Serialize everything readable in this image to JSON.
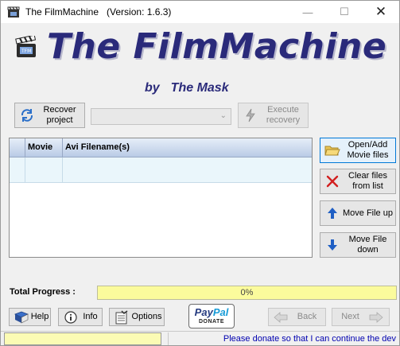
{
  "window": {
    "title": "The FilmMachine",
    "version": "(Version: 1.6.3)"
  },
  "brand": {
    "title": "The FilmMachine",
    "by": "by",
    "author": "The Mask"
  },
  "toolbar": {
    "recover_line1": "Recover",
    "recover_line2": "project",
    "project_select_value": "",
    "execute_line1": "Execute",
    "execute_line2": "recovery"
  },
  "table": {
    "columns": [
      "",
      "Movie",
      "Avi Filename(s)"
    ]
  },
  "side_buttons": {
    "open_add_line1": "Open/Add",
    "open_add_line2": "Movie files",
    "clear_line1": "Clear files",
    "clear_line2": "from list",
    "move_up": "Move File up",
    "move_down_line1": "Move File",
    "move_down_line2": "down"
  },
  "progress": {
    "label": "Total Progress :",
    "value": 0,
    "text": "0%"
  },
  "bottom": {
    "help": "Help",
    "info": "Info",
    "options": "Options",
    "back": "Back",
    "next": "Next"
  },
  "paypal": {
    "brand_part1": "Pay",
    "brand_part2": "Pal",
    "donate": "DONATE"
  },
  "status": {
    "message": "Please donate so that I can continue the dev"
  },
  "colors": {
    "brand": "#2a2a7a",
    "progress_bg": "#fbfb9c",
    "status_text": "#0000b0",
    "header": "#b9cbe6"
  }
}
